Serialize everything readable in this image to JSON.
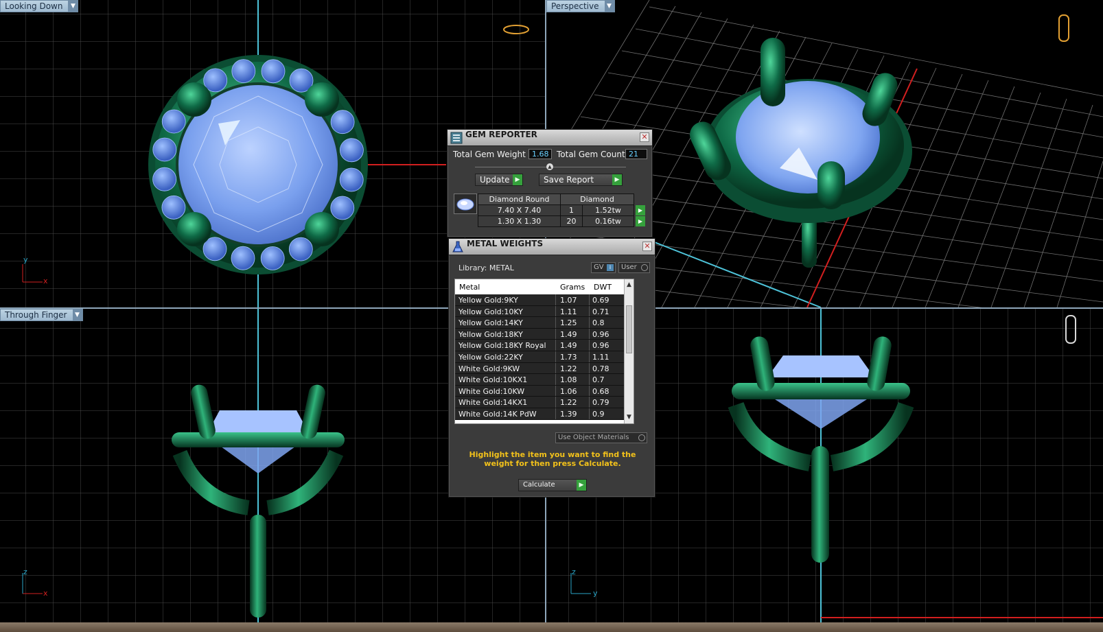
{
  "viewports": {
    "top_left": {
      "label": "Looking Down",
      "axes": [
        "y",
        "x"
      ]
    },
    "top_right": {
      "label": "Perspective"
    },
    "bottom_left": {
      "label": "Through Finger",
      "axes": [
        "z",
        "x"
      ]
    },
    "bottom_right": {
      "axes": [
        "z",
        "y"
      ]
    }
  },
  "gem_reporter": {
    "title": "GEM REPORTER",
    "total_weight_label": "Total Gem Weight",
    "total_weight_value": "1.68",
    "total_count_label": "Total Gem Count",
    "total_count_value": "21",
    "update_label": "Update",
    "save_report_label": "Save Report",
    "header_shape": "Diamond Round",
    "header_type": "Diamond",
    "rows": [
      {
        "size": "7.40 X 7.40",
        "count": "1",
        "weight": "1.52tw"
      },
      {
        "size": "1.30 X 1.30",
        "count": "20",
        "weight": "0.16tw"
      }
    ]
  },
  "metal_weights": {
    "title": "METAL WEIGHTS",
    "library_label": "Library: METAL",
    "gv_label": "GV",
    "user_label": "User",
    "col_metal": "Metal",
    "col_grams": "Grams",
    "col_dwt": "DWT",
    "rows": [
      {
        "metal": "Yellow Gold:9KY",
        "grams": "1.07",
        "dwt": "0.69"
      },
      {
        "metal": "Yellow Gold:10KY",
        "grams": "1.11",
        "dwt": "0.71"
      },
      {
        "metal": "Yellow Gold:14KY",
        "grams": "1.25",
        "dwt": "0.8"
      },
      {
        "metal": "Yellow Gold:18KY",
        "grams": "1.49",
        "dwt": "0.96"
      },
      {
        "metal": "Yellow Gold:18KY Royal",
        "grams": "1.49",
        "dwt": "0.96"
      },
      {
        "metal": "Yellow Gold:22KY",
        "grams": "1.73",
        "dwt": "1.11"
      },
      {
        "metal": "White Gold:9KW",
        "grams": "1.22",
        "dwt": "0.78"
      },
      {
        "metal": "White Gold:10KX1",
        "grams": "1.08",
        "dwt": "0.7"
      },
      {
        "metal": "White Gold:10KW",
        "grams": "1.06",
        "dwt": "0.68"
      },
      {
        "metal": "White Gold:14KX1",
        "grams": "1.22",
        "dwt": "0.79"
      },
      {
        "metal": "White Gold:14K PdW",
        "grams": "1.39",
        "dwt": "0.9"
      }
    ],
    "use_object_materials_label": "Use Object Materials",
    "hint": "Highlight the item you want to find the weight for then press Calculate.",
    "calculate_label": "Calculate"
  },
  "colors": {
    "metal_green": "#0f6b47",
    "gem_blue": "#6f97ea",
    "grid_line": "#4a4a4a",
    "axis_cyan": "#4ec3d9",
    "axis_red": "#d21f1f",
    "hint_yellow": "#f3c21a"
  }
}
